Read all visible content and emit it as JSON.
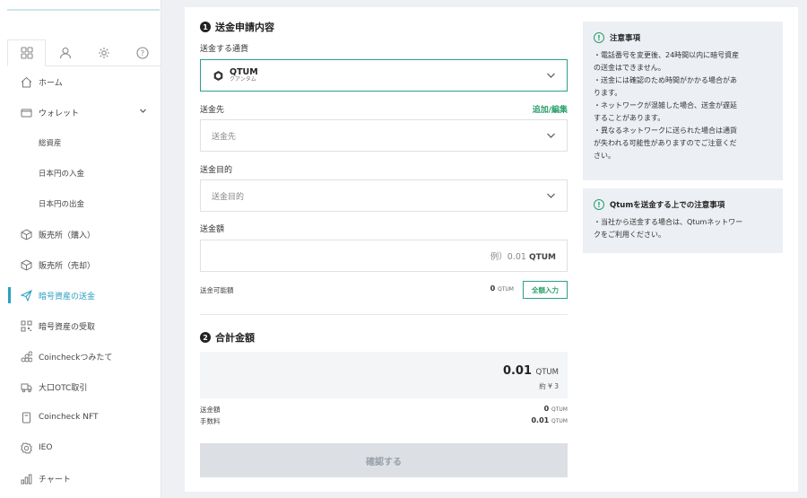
{
  "sidebar": {
    "tabs": [
      {
        "icon": "grid-icon"
      },
      {
        "icon": "user-icon"
      },
      {
        "icon": "gear-icon"
      },
      {
        "icon": "help-icon"
      }
    ],
    "items": [
      {
        "label": "ホーム"
      },
      {
        "label": "ウォレット"
      },
      {
        "label": "総資産"
      },
      {
        "label": "日本円の入金"
      },
      {
        "label": "日本円の出金"
      },
      {
        "label": "販売所（購入）"
      },
      {
        "label": "販売所（売却）"
      },
      {
        "label": "暗号資産の送金"
      },
      {
        "label": "暗号資産の受取"
      },
      {
        "label": "Coincheckつみたて"
      },
      {
        "label": "大口OTC取引"
      },
      {
        "label": "Coincheck NFT"
      },
      {
        "label": "IEO"
      },
      {
        "label": "チャート"
      }
    ]
  },
  "form": {
    "section1_num": "1",
    "section1_title": "送金申請内容",
    "currency_label": "送金する通貨",
    "currency_name": "QTUM",
    "currency_sub": "クアンタム",
    "dest_label": "送金先",
    "add_edit": "追加/編集",
    "dest_placeholder": "送金先",
    "purpose_label": "送金目的",
    "purpose_placeholder": "送金目的",
    "amount_label": "送金額",
    "amount_placeholder": "例）0.01",
    "amount_unit": "QTUM",
    "available_label": "送金可能額",
    "available_value": "0",
    "available_unit": "QTUM",
    "fill_all": "全額入力",
    "section2_num": "2",
    "section2_title": "合計金額",
    "total_value": "0.01",
    "total_unit": "QTUM",
    "total_yen": "約 ¥ 3",
    "send_amount_label": "送金額",
    "send_amount_value": "0",
    "send_amount_unit": "QTUM",
    "fee_label": "手数料",
    "fee_value": "0.01",
    "fee_unit": "QTUM",
    "confirm": "確認する"
  },
  "notes": [
    {
      "title": "注意事項",
      "lines": [
        "・電話番号を変更後、24時間以内に暗号資産",
        "の送金はできません。",
        "・送金には確認のため時間がかかる場合があ",
        "ります。",
        "・ネットワークが混雑した場合、送金が遅延",
        "することがあります。",
        "・異なるネットワークに送られた場合は通貨",
        "が失われる可能性がありますのでご注意くだ",
        "さい。"
      ]
    },
    {
      "title": "Qtumを送金する上での注意事項",
      "lines": [
        "・当社から送金する場合は、Qtumネットワー",
        "クをご利用ください。"
      ]
    }
  ],
  "colors": {
    "accent": "#2a9fc0",
    "green": "#2a9f6a"
  }
}
